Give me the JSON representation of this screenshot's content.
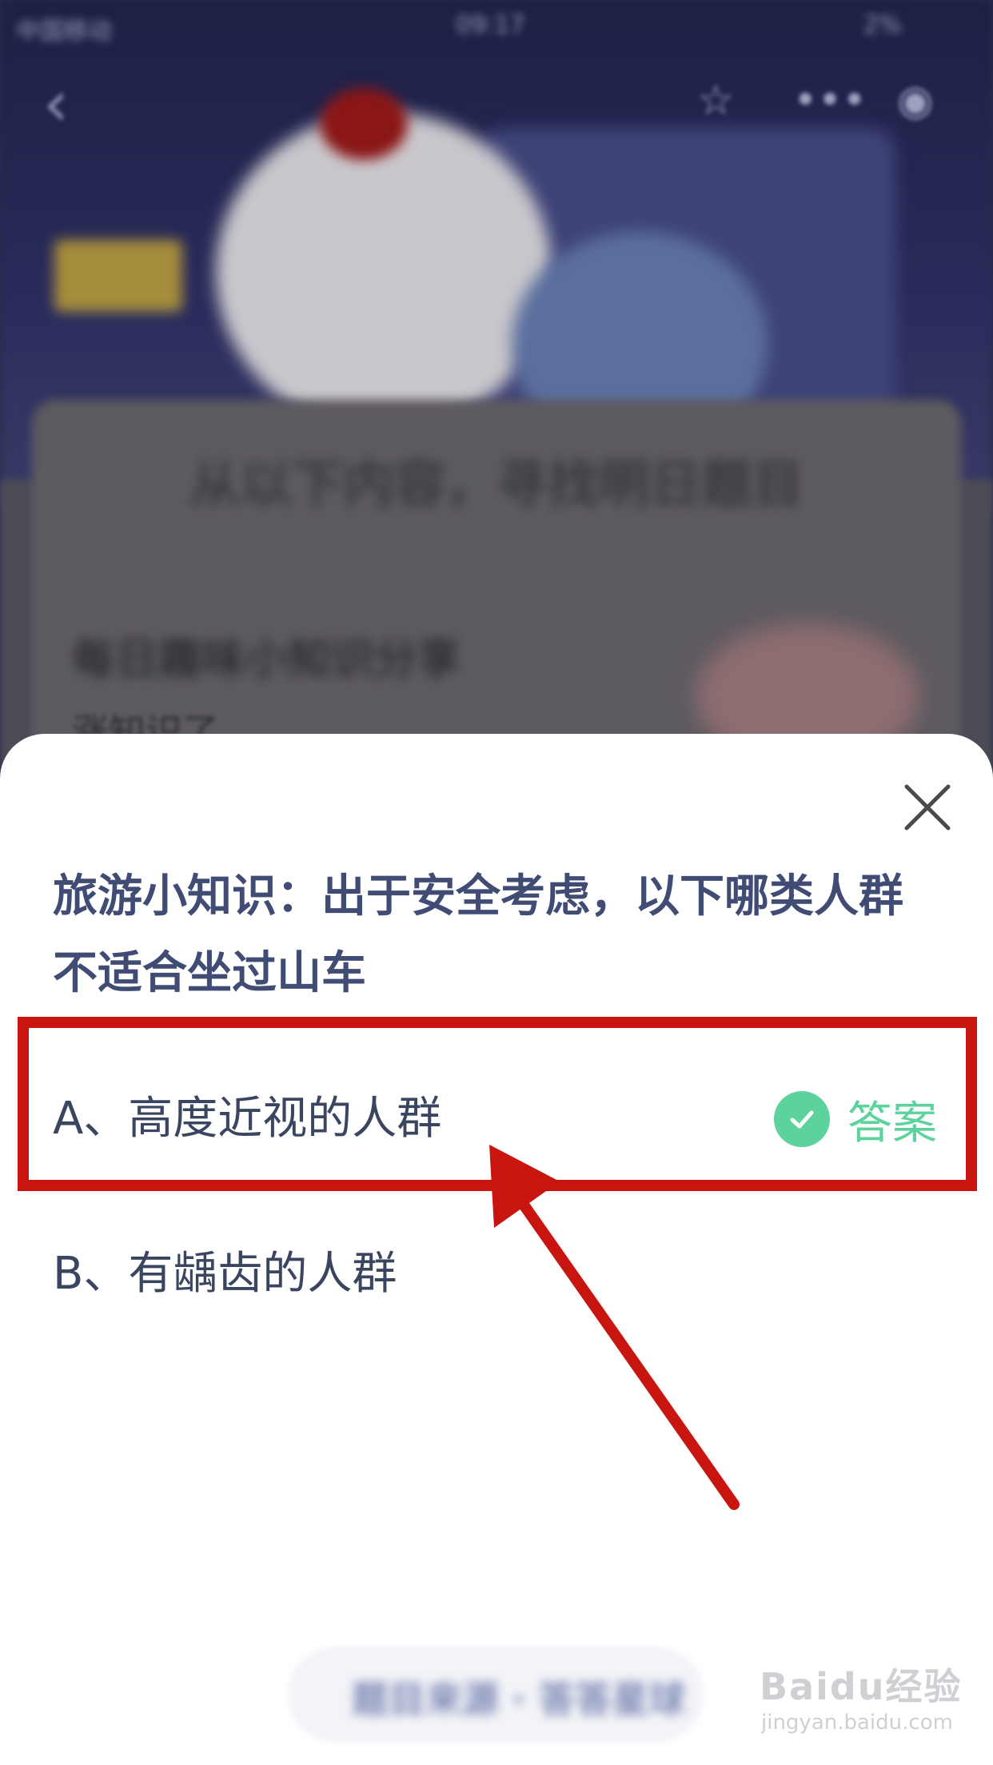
{
  "status_bar": {
    "carrier": "中国移动",
    "time": "09:17",
    "battery": "2%"
  },
  "background": {
    "heading": "从以下内容，寻找明日题目",
    "card_title": "每日趣味小知识分享",
    "card_subtitle": "涨知识了"
  },
  "quiz": {
    "question": "旅游小知识：出于安全考虑，以下哪类人群不适合坐过山车",
    "options": [
      {
        "label": "A、高度近视的人群",
        "is_answer": true
      },
      {
        "label": "B、有龋齿的人群",
        "is_answer": false
      }
    ],
    "answer_label": "答案"
  },
  "footer": {
    "text": "题目来源 · 答答星球"
  },
  "watermark": {
    "brand": "Baidu经验",
    "url": "jingyan.baidu.com"
  },
  "colors": {
    "accent_green": "#5cd39c",
    "highlight_red": "#c8150f",
    "question_text": "#404c74"
  }
}
